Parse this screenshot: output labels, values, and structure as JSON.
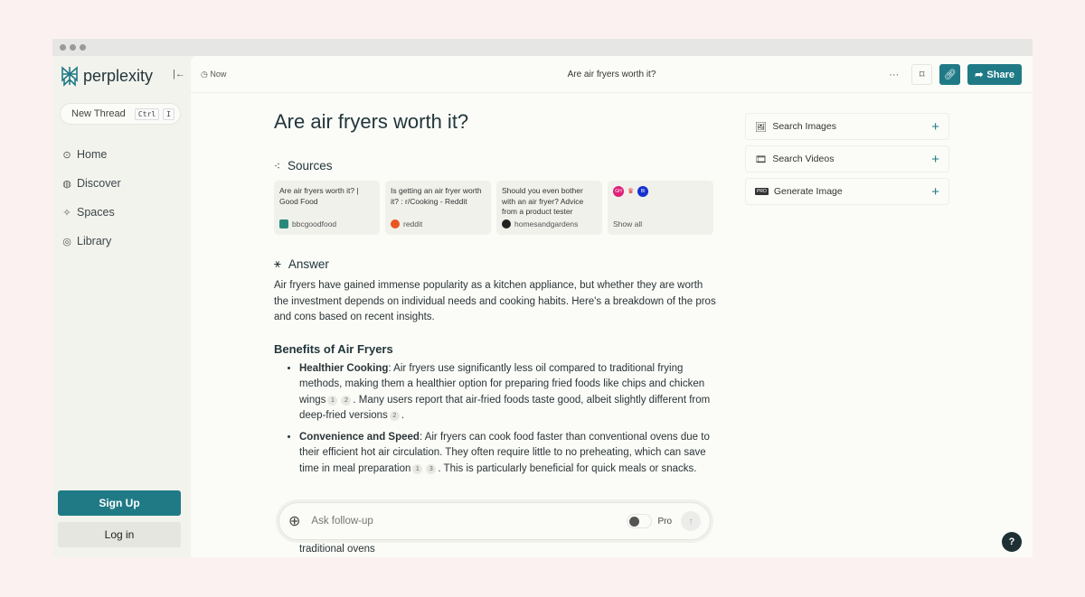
{
  "sidebar": {
    "brand": "perplexity",
    "new_thread": "New Thread",
    "shortcut": [
      "Ctrl",
      "I"
    ],
    "items": [
      {
        "label": "Home",
        "icon": "home-icon"
      },
      {
        "label": "Discover",
        "icon": "globe-icon"
      },
      {
        "label": "Spaces",
        "icon": "spaces-icon"
      },
      {
        "label": "Library",
        "icon": "library-icon"
      }
    ],
    "sign_up": "Sign Up",
    "log_in": "Log in"
  },
  "header": {
    "time": "Now",
    "title": "Are air fryers worth it?",
    "share": "Share"
  },
  "main": {
    "question": "Are air fryers worth it?",
    "sources_label": "Sources",
    "sources": [
      {
        "title": "Are air fryers worth it? | Good Food",
        "site": "bbcgoodfood",
        "color": "#2a8a7a"
      },
      {
        "title": "Is getting an air fryer worth it? : r/Cooking - Reddit",
        "site": "reddit",
        "color": "#e8571f"
      },
      {
        "title": "Should you even bother with an air fryer? Advice from a product tester",
        "site": "homesandgardens",
        "color": "#222222"
      }
    ],
    "show_all": "Show all",
    "show_all_icons": [
      "GH",
      "BI"
    ],
    "answer_label": "Answer",
    "intro": "Air fryers have gained immense popularity as a kitchen appliance, but whether they are worth the investment depends on individual needs and cooking habits. Here's a breakdown of the pros and cons based on recent insights.",
    "benefits_heading": "Benefits of Air Fryers",
    "b1": {
      "bold": "Healthier Cooking",
      "t1": ": Air fryers use significantly less oil compared to traditional frying methods, making them a healthier option for preparing fried foods like chips and chicken wings",
      "c1": "1",
      "c2": "2",
      "t2": ". Many users report that air-fried foods taste good, albeit slightly different from deep-fried versions",
      "c3": "2",
      "t3": "."
    },
    "b2": {
      "bold": "Convenience and Speed",
      "t1": ": Air fryers can cook food faster than conventional ovens due to their efficient hot air circulation. They often require little to no preheating, which can save time in meal preparation",
      "c1": "1",
      "c2": "3",
      "t2": ". This is particularly beneficial for quick meals or snacks."
    },
    "cut_text": "traditional ovens"
  },
  "right": {
    "items": [
      "Search Images",
      "Search Videos",
      "Generate Image"
    ]
  },
  "ask": {
    "placeholder": "Ask follow-up",
    "pro": "Pro"
  },
  "help": "?",
  "colors": {
    "accent": "#1f7a86",
    "background": "#fcf1f1"
  }
}
